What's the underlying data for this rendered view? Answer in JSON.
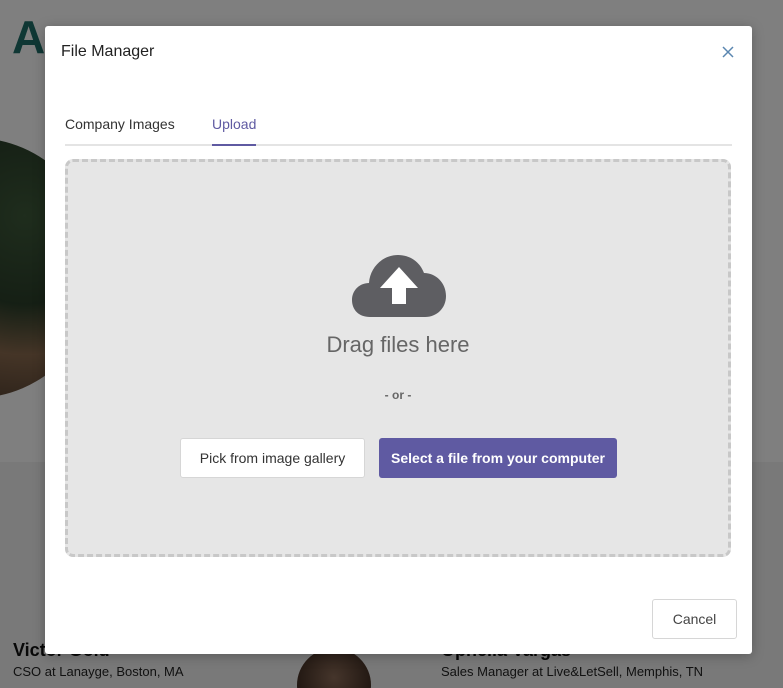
{
  "background": {
    "logo_letter": "A",
    "people": [
      {
        "name": "Victor Gold",
        "role": "CSO at Lanayge, Boston, MA"
      },
      {
        "name": "Ophelia Vargas",
        "role": "Sales Manager at Live&LetSell, Memphis, TN"
      }
    ]
  },
  "modal": {
    "title": "File Manager",
    "close_icon": "close-icon",
    "tabs": [
      {
        "label": "Company Images",
        "active": false
      },
      {
        "label": "Upload",
        "active": true
      }
    ],
    "dropzone": {
      "icon": "cloud-upload-icon",
      "drag_text": "Drag files here",
      "or_text": "- or -",
      "gallery_button": "Pick from image gallery",
      "computer_button": "Select a file from your computer"
    },
    "cancel_button": "Cancel"
  },
  "colors": {
    "accent": "#5f5aa2",
    "dropzone_bg": "#e6e6e6",
    "overlay": "rgba(0,0,0,0.5)"
  }
}
